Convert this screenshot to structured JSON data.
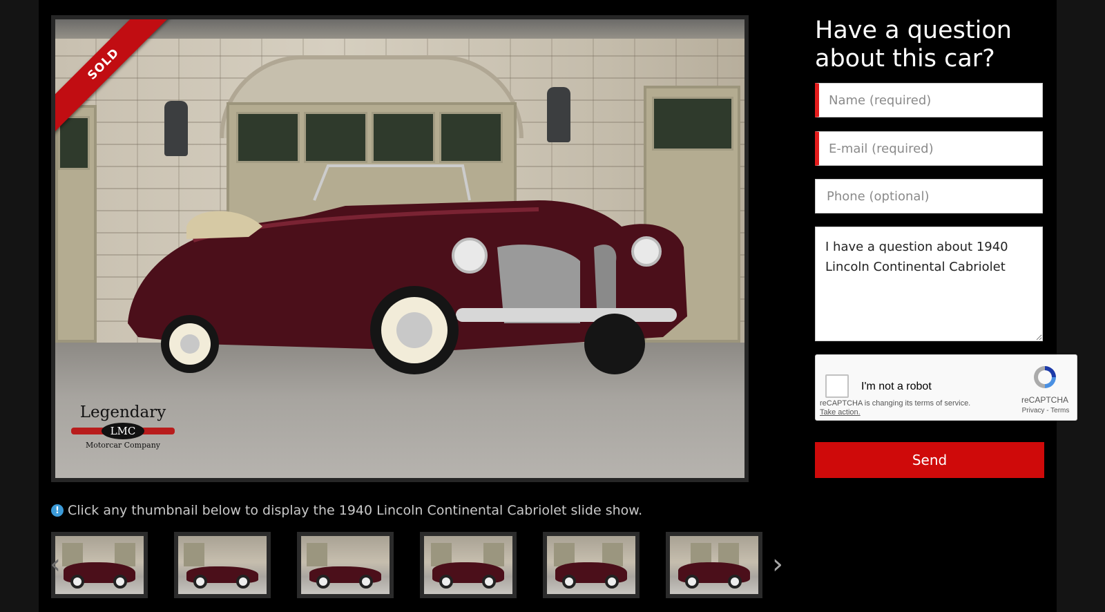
{
  "photo": {
    "badge": "SOLD",
    "logo": {
      "line1": "Legendary",
      "line2": "LMC",
      "line3": "Motorcar Company"
    }
  },
  "info": {
    "icon": "exclamation-circle-icon",
    "text": "Click any thumbnail below to display the 1940 Lincoln Continental Cabriolet slide show."
  },
  "thumbnails": {
    "count": 6,
    "prev_icon": "chevron-left-icon",
    "next_icon": "chevron-right-icon"
  },
  "form": {
    "title": "Have a question about this car?",
    "name_placeholder": "Name (required)",
    "email_placeholder": "E-mail (required)",
    "phone_placeholder": "Phone (optional)",
    "message": "I have a question about 1940 Lincoln Continental Cabriolet",
    "send_label": "Send"
  },
  "recaptcha": {
    "label": "I'm not a robot",
    "note": "reCAPTCHA is changing its terms of service.",
    "action": "Take action.",
    "brand": "reCAPTCHA",
    "links": "Privacy - Terms"
  },
  "colors": {
    "accent_red": "#cf0a0a",
    "required_marker": "#e21b1b",
    "car_body": "#4b0f1a"
  }
}
